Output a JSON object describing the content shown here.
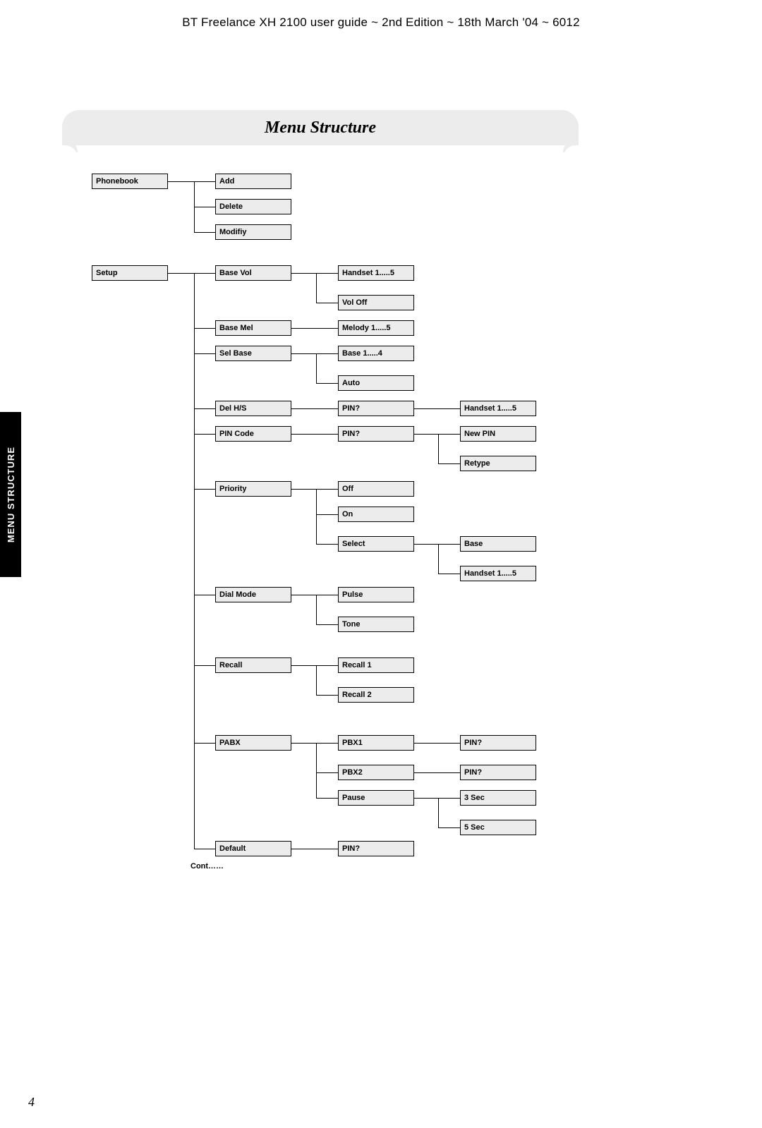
{
  "header": "BT Freelance XH 2100 user guide ~ 2nd Edition ~ 18th March '04 ~ 6012",
  "title": "Menu Structure",
  "side_tab": "MENU STRUCTURE",
  "page_number": "4",
  "cont_label": "Cont……",
  "boxes": {
    "phonebook": "Phonebook",
    "add": "Add",
    "delete": "Delete",
    "modify": "Modifiy",
    "setup": "Setup",
    "base_vol": "Base Vol",
    "handset15_a": "Handset 1.....5",
    "vol_off": "Vol Off",
    "base_mel": "Base Mel",
    "melody15": "Melody 1.....5",
    "sel_base": "Sel Base",
    "base14": "Base 1.....4",
    "auto": "Auto",
    "del_hs": "Del H/S",
    "pin_a": "PIN?",
    "handset15_b": "Handset 1.....5",
    "pin_code": "PIN Code",
    "pin_b": "PIN?",
    "new_pin": "New PIN",
    "retype": "Retype",
    "priority": "Priority",
    "off": "Off",
    "on": "On",
    "select": "Select",
    "base": "Base",
    "handset15_c": "Handset 1.....5",
    "dial_mode": "Dial Mode",
    "pulse": "Pulse",
    "tone": "Tone",
    "recall": "Recall",
    "recall1": "Recall 1",
    "recall2": "Recall 2",
    "pabx": "PABX",
    "pbx1": "PBX1",
    "pin_c": "PIN?",
    "pbx2": "PBX2",
    "pin_d": "PIN?",
    "pause": "Pause",
    "sec3": "3 Sec",
    "sec5": "5 Sec",
    "default": "Default",
    "pin_e": "PIN?"
  }
}
